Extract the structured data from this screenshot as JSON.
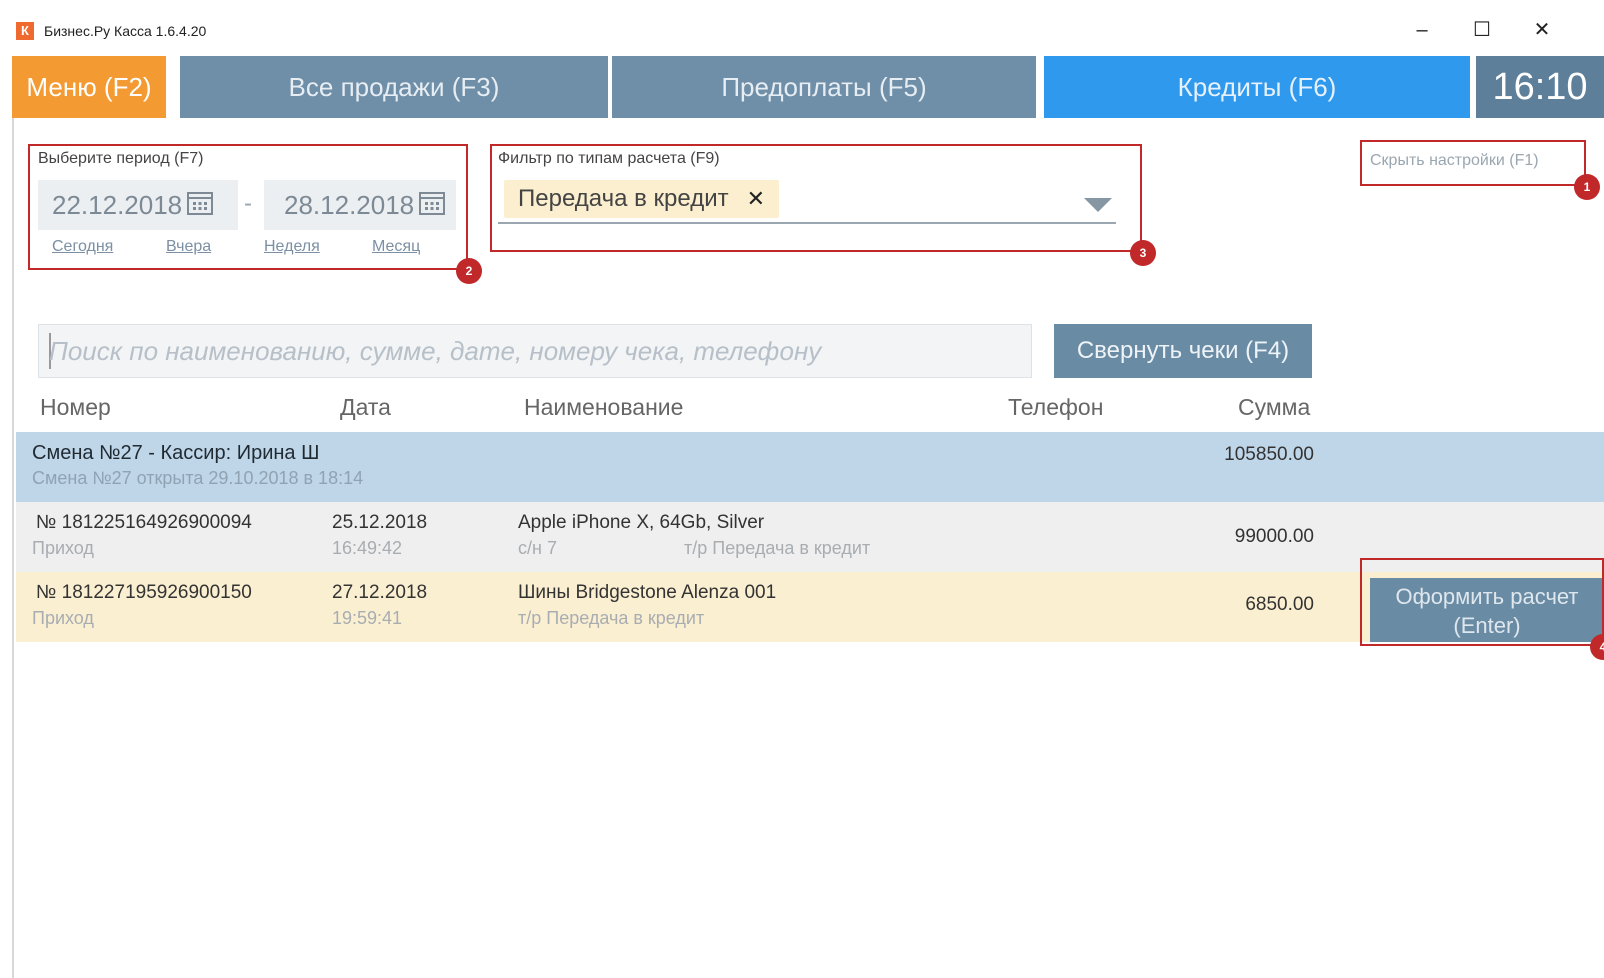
{
  "window": {
    "title": "Бизнес.Ру Касса 1.6.4.20",
    "icon_letter": "К",
    "minimize": "–",
    "maximize": "☐",
    "close": "✕"
  },
  "nav": {
    "menu": "Меню (F2)",
    "sales": "Все продажи (F3)",
    "prepay": "Предоплаты (F5)",
    "credit": "Кредиты (F6)",
    "clock": "16:10"
  },
  "period": {
    "label": "Выберите период (F7)",
    "from": "22.12.2018",
    "to": "28.12.2018",
    "separator": "-",
    "quick": [
      "Сегодня",
      "Вчера",
      "Неделя",
      "Месяц"
    ]
  },
  "filter": {
    "label": "Фильтр по типам расчета (F9)",
    "chip": "Передача в кредит",
    "chip_remove": "✕"
  },
  "settings": {
    "hide": "Скрыть настройки (F1)"
  },
  "badges": [
    "1",
    "2",
    "3",
    "4"
  ],
  "search": {
    "placeholder": "Поиск по наименованию, сумме, дате, номеру чека, телефону",
    "value": ""
  },
  "collapse_button": "Свернуть чеки (F4)",
  "columns": [
    "Номер",
    "Дата",
    "Наименование",
    "Телефон",
    "Сумма"
  ],
  "shift": {
    "title": "Смена №27 - Кассир: Ирина Ш",
    "subtitle": "Смена №27 открыта 29.10.2018 в 18:14",
    "total": "105850.00"
  },
  "rows": [
    {
      "number": "№ 181225164926900094",
      "type": "Приход",
      "date": "25.12.2018",
      "time": "16:49:42",
      "name": "Apple iPhone X, 64Gb, Silver",
      "sub1": "с/н 7",
      "sub2": "т/р Передача в кредит",
      "amount": "99000.00"
    },
    {
      "number": "№ 181227195926900150",
      "type": "Приход",
      "date": "27.12.2018",
      "time": "19:59:41",
      "name": "Шины Bridgestone Alenza 001",
      "sub1": "т/р Передача в кредит",
      "sub2": "",
      "amount": "6850.00"
    }
  ],
  "pay_button": {
    "line1": "Оформить расчет",
    "line2": "(Enter)"
  },
  "colors": {
    "menu": "#f39a32",
    "tab": "#6f8ea7",
    "tab_active": "#2f99ee",
    "highlight": "#c0282a",
    "shift_row": "#bfd6e8",
    "selected_row": "#fbefd1"
  }
}
